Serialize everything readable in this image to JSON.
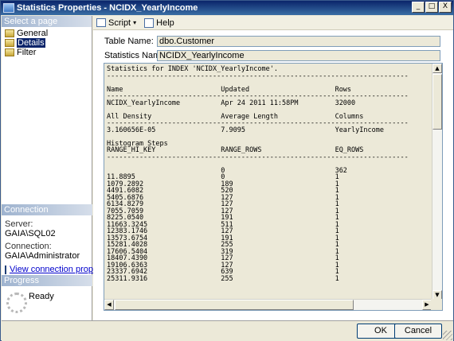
{
  "window": {
    "title": "Statistics Properties - NCIDX_YearlyIncome",
    "minimize_glyph": "_",
    "maximize_glyph": "□",
    "close_glyph": "X"
  },
  "left_pane": {
    "select_page_header": "Select a page",
    "pages": [
      {
        "label": "General",
        "icon": "page-icon",
        "selected": false
      },
      {
        "label": "Details",
        "icon": "page-icon",
        "selected": true
      },
      {
        "label": "Filter",
        "icon": "page-icon",
        "selected": false
      }
    ],
    "connection_header": "Connection",
    "server_label": "Server:",
    "server_value": "GAIA\\SQL02",
    "connection_label": "Connection:",
    "connection_value": "GAIA\\Administrator",
    "view_connection_link": "View connection properties",
    "progress_header": "Progress",
    "progress_status": "Ready"
  },
  "toolbar": {
    "script_label": "Script",
    "script_caret": "▾",
    "help_label": "Help"
  },
  "form": {
    "table_name_label": "Table Name:",
    "table_name_value": "dbo.Customer",
    "statistics_name_label": "Statistics Name:",
    "statistics_name_value": "NCIDX_YearlyIncome"
  },
  "statistics": {
    "header_line": "Statistics for INDEX 'NCIDX_YearlyIncome'.",
    "separator": "--------------------------------------------------------------------------",
    "stats_columns": [
      "Name",
      "Updated",
      "Rows"
    ],
    "stats_row": [
      "NCIDX_YearlyIncome",
      "Apr 24 2011 11:58PM",
      "32000"
    ],
    "density_columns": [
      "All Density",
      "Average Length",
      "Columns"
    ],
    "density_row": [
      "3.160656E-05",
      "7.9095",
      "YearlyIncome"
    ],
    "histogram_title": "Histogram Steps",
    "histogram_columns": [
      "RANGE_HI_KEY",
      "RANGE_ROWS",
      "EQ_ROWS"
    ],
    "histogram_rows": [
      [
        "",
        "0",
        "362"
      ],
      [
        "11.8895",
        "0",
        "1"
      ],
      [
        "1079.2892",
        "189",
        "1"
      ],
      [
        "4491.6082",
        "520",
        "1"
      ],
      [
        "5405.6876",
        "127",
        "1"
      ],
      [
        "6134.8279",
        "127",
        "1"
      ],
      [
        "7055.7059",
        "127",
        "1"
      ],
      [
        "8225.0540",
        "191",
        "1"
      ],
      [
        "11663.3245",
        "511",
        "1"
      ],
      [
        "12383.1746",
        "127",
        "1"
      ],
      [
        "13573.6754",
        "191",
        "1"
      ],
      [
        "15281.4028",
        "255",
        "1"
      ],
      [
        "17606.5404",
        "319",
        "1"
      ],
      [
        "18407.4390",
        "127",
        "1"
      ],
      [
        "19106.6363",
        "127",
        "1"
      ],
      [
        "23337.6942",
        "639",
        "1"
      ],
      [
        "25311.9316",
        "255",
        "1"
      ]
    ]
  },
  "footer": {
    "ok_label": "OK",
    "cancel_label": "Cancel"
  },
  "colors": {
    "title_bar": "#0a246a",
    "pane_header": "#9eb3cf",
    "link": "#0000cc",
    "dialog_face": "#ece9d8"
  }
}
